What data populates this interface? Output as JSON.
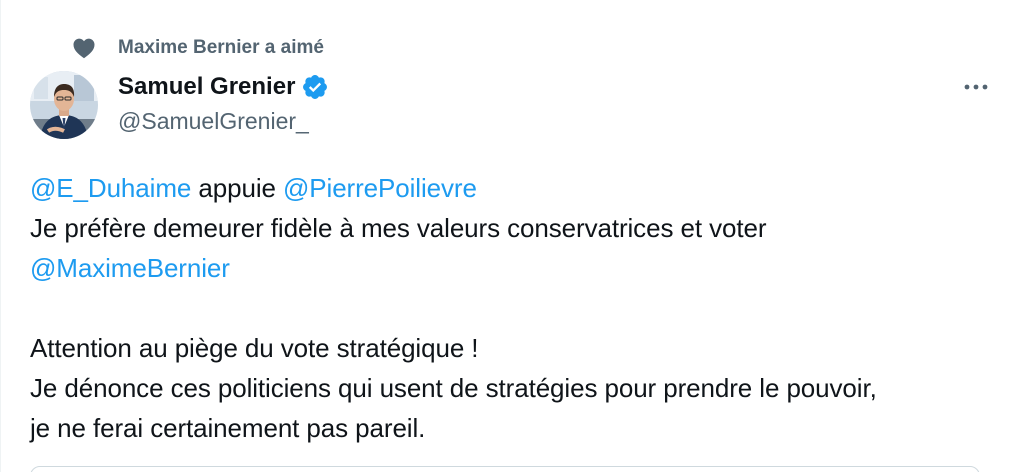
{
  "social_context": {
    "icon": "heart-icon",
    "text": "Maxime Bernier a aimé"
  },
  "author": {
    "name": "Samuel Grenier",
    "handle": "@SamuelGrenier_",
    "verified": true,
    "verified_color": "#1d9bf0"
  },
  "more_icon": "more-horizontal-icon",
  "body": {
    "line1_mention1": "@E_Duhaime",
    "line1_text": " appuie ",
    "line1_mention2": "@PierrePoilievre",
    "line2": "Je préfère demeurer fidèle à mes valeurs conservatrices et voter",
    "line3_mention": "@MaximeBernier",
    "line4": "Attention au piège du vote stratégique !",
    "line5": "Je dénonce ces politiciens qui usent de stratégies pour prendre le pouvoir,",
    "line6": "je ne ferai certainement pas pareil."
  },
  "colors": {
    "link": "#1d9bf0",
    "secondary_text": "#536471",
    "primary_text": "#0f1419"
  }
}
